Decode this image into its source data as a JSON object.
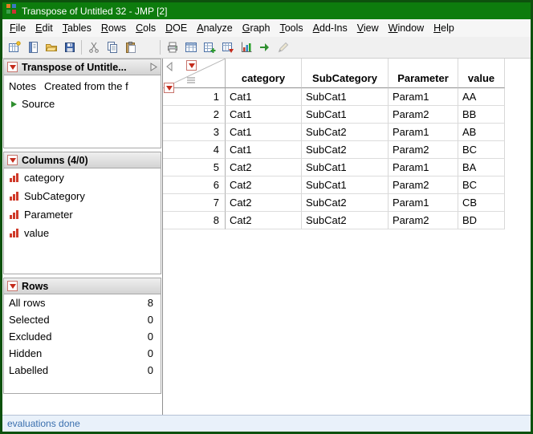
{
  "window": {
    "title": "Transpose of Untitled 32 - JMP [2]"
  },
  "menu": {
    "items": [
      "File",
      "Edit",
      "Tables",
      "Rows",
      "Cols",
      "DOE",
      "Analyze",
      "Graph",
      "Tools",
      "Add-Ins",
      "View",
      "Window",
      "Help"
    ]
  },
  "toolbar": {
    "buttons": [
      "new-data-table",
      "new-journal",
      "open",
      "save",
      "cut",
      "copy",
      "paste",
      "print",
      "data-table",
      "new-column",
      "table-menu",
      "chart",
      "run-script",
      "annotate"
    ]
  },
  "sidebar": {
    "table_panel": {
      "title": "Transpose of Untitle...",
      "notes_label": "Notes",
      "notes_value": "Created from the f",
      "source_label": "Source"
    },
    "columns_panel": {
      "title": "Columns (4/0)",
      "items": [
        "category",
        "SubCategory",
        "Parameter",
        "value"
      ]
    },
    "rows_panel": {
      "title": "Rows",
      "stats": [
        {
          "label": "All rows",
          "value": "8"
        },
        {
          "label": "Selected",
          "value": "0"
        },
        {
          "label": "Excluded",
          "value": "0"
        },
        {
          "label": "Hidden",
          "value": "0"
        },
        {
          "label": "Labelled",
          "value": "0"
        }
      ]
    }
  },
  "table": {
    "columns": [
      "category",
      "SubCategory",
      "Parameter",
      "value"
    ],
    "rows": [
      {
        "n": "1",
        "cells": [
          "Cat1",
          "SubCat1",
          "Param1",
          "AA"
        ]
      },
      {
        "n": "2",
        "cells": [
          "Cat1",
          "SubCat1",
          "Param2",
          "BB"
        ]
      },
      {
        "n": "3",
        "cells": [
          "Cat1",
          "SubCat2",
          "Param1",
          "AB"
        ]
      },
      {
        "n": "4",
        "cells": [
          "Cat1",
          "SubCat2",
          "Param2",
          "BC"
        ]
      },
      {
        "n": "5",
        "cells": [
          "Cat2",
          "SubCat1",
          "Param1",
          "BA"
        ]
      },
      {
        "n": "6",
        "cells": [
          "Cat2",
          "SubCat1",
          "Param2",
          "BC"
        ]
      },
      {
        "n": "7",
        "cells": [
          "Cat2",
          "SubCat2",
          "Param1",
          "CB"
        ]
      },
      {
        "n": "8",
        "cells": [
          "Cat2",
          "SubCat2",
          "Param2",
          "BD"
        ]
      }
    ]
  },
  "statusbar": {
    "text": "evaluations done"
  },
  "colors": {
    "title_green": "#0d7c0d",
    "border_green": "#0d510d",
    "red_triangle": "#c42b1c",
    "status_text": "#3a6fae"
  }
}
